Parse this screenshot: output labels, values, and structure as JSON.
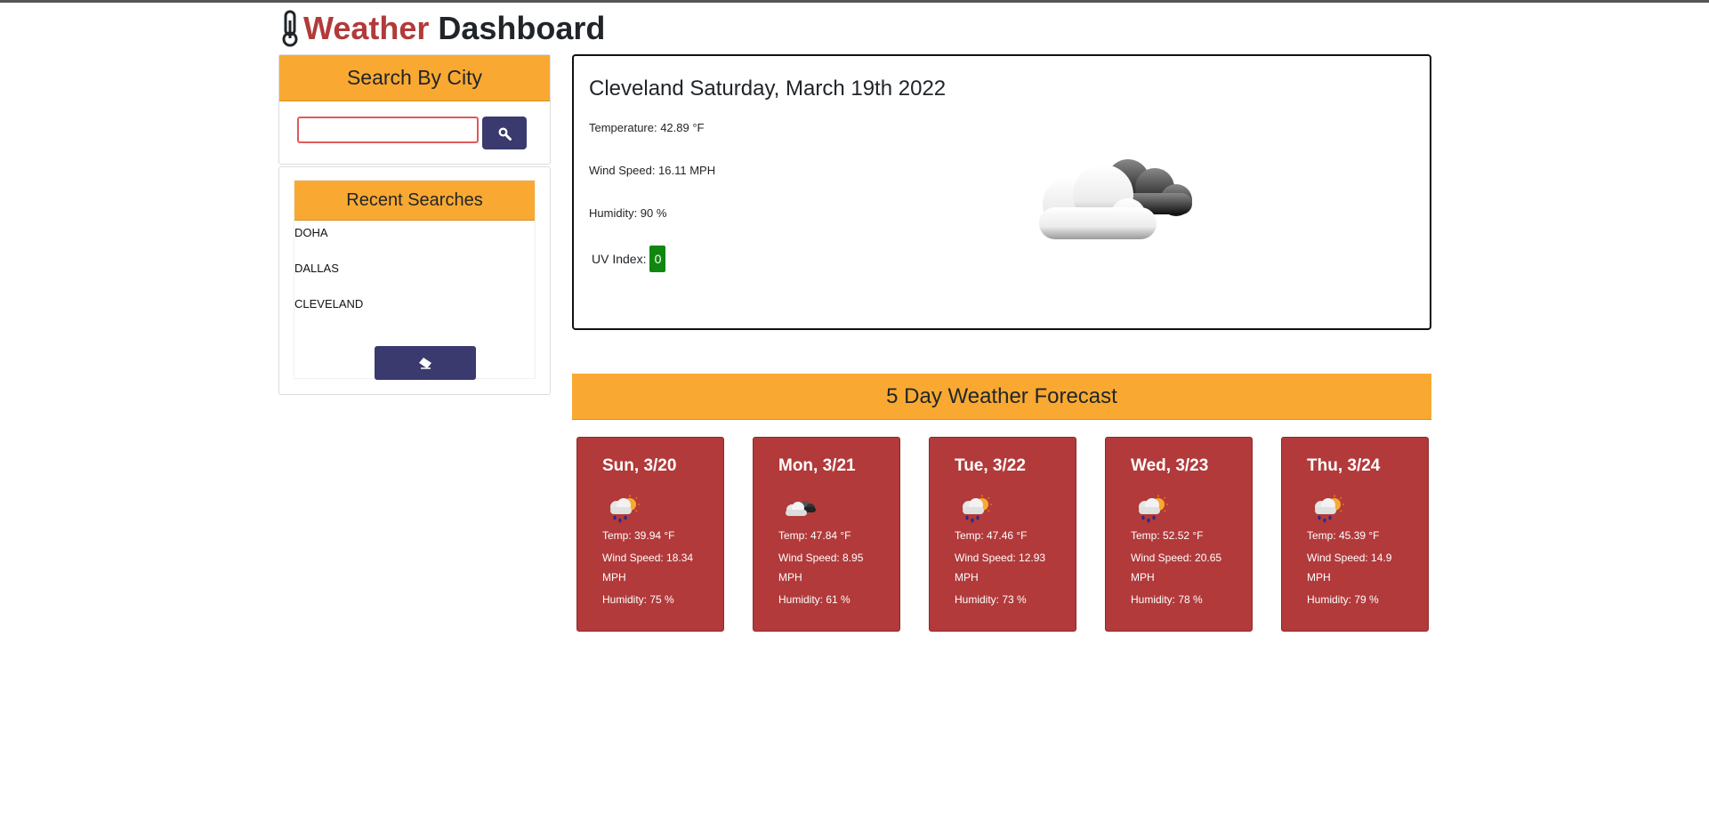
{
  "header": {
    "title_part1": "Weather",
    "title_part2": " Dashboard"
  },
  "search": {
    "heading": "Search By City",
    "input_value": "",
    "input_placeholder": "",
    "button_icon": "search-icon"
  },
  "recent": {
    "heading": "Recent Searches",
    "items": [
      "DOHA",
      "DALLAS",
      "CLEVELAND"
    ],
    "clear_icon": "eraser-icon"
  },
  "current": {
    "city_date": "Cleveland Saturday, March 19th 2022",
    "temperature": "Temperature: 42.89 °F",
    "wind": "Wind Speed: 16.11 MPH",
    "humidity": "Humidity: 90 %",
    "uv_label": "UV Index:",
    "uv_value": "0",
    "uv_color": "#118711",
    "icon": "cloudy-night-icon"
  },
  "forecast": {
    "heading": "5 Day Weather Forecast",
    "days": [
      {
        "date": "Sun, 3/20",
        "icon": "rain-sun-icon",
        "temp": "Temp: 39.94 °F",
        "wind": "Wind Speed: 18.34 MPH",
        "humidity": "Humidity: 75 %"
      },
      {
        "date": "Mon, 3/21",
        "icon": "cloud-night-icon",
        "temp": "Temp: 47.84 °F",
        "wind": "Wind Speed: 8.95 MPH",
        "humidity": "Humidity: 61 %"
      },
      {
        "date": "Tue, 3/22",
        "icon": "rain-sun-icon",
        "temp": "Temp: 47.46 °F",
        "wind": "Wind Speed: 12.93 MPH",
        "humidity": "Humidity: 73 %"
      },
      {
        "date": "Wed, 3/23",
        "icon": "rain-sun-icon",
        "temp": "Temp: 52.52 °F",
        "wind": "Wind Speed: 20.65 MPH",
        "humidity": "Humidity: 78 %"
      },
      {
        "date": "Thu, 3/24",
        "icon": "rain-sun-icon",
        "temp": "Temp: 45.39 °F",
        "wind": "Wind Speed: 14.9 MPH",
        "humidity": "Humidity: 79 %"
      }
    ]
  },
  "colors": {
    "accent": "#f9a932",
    "card": "#b23a3a",
    "button": "#3a3a6e"
  }
}
